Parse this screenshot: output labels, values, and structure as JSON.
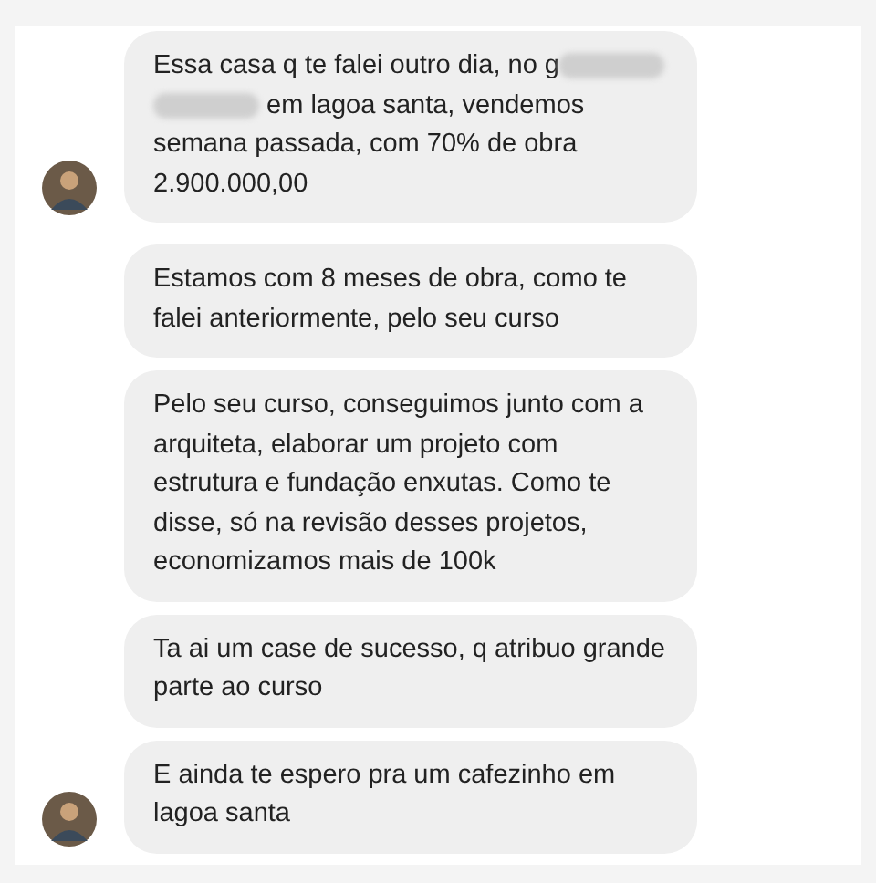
{
  "groups": [
    {
      "messages": [
        {
          "parts": [
            {
              "kind": "text",
              "text": "Essa casa q te falei outro dia, no g"
            },
            {
              "kind": "redacted"
            },
            {
              "kind": "break"
            },
            {
              "kind": "redacted"
            },
            {
              "kind": "text",
              "text": " em lagoa santa, vendemos semana passada, com 70% de obra 2.900.000,00"
            }
          ]
        }
      ]
    },
    {
      "messages": [
        {
          "parts": [
            {
              "kind": "text",
              "text": "Estamos com 8 meses de obra, como te falei anteriormente, pelo seu curso"
            }
          ]
        },
        {
          "parts": [
            {
              "kind": "text",
              "text": "Pelo seu curso, conseguimos junto com a arquiteta, elaborar um projeto com estrutura e fundação enxutas. Como te disse, só na revisão desses projetos, economizamos mais de 100k"
            }
          ]
        },
        {
          "parts": [
            {
              "kind": "text",
              "text": "Ta ai um case de sucesso, q atribuo grande parte ao curso"
            }
          ]
        },
        {
          "parts": [
            {
              "kind": "text",
              "text": "E ainda te espero pra um cafezinho em lagoa santa"
            }
          ]
        }
      ]
    }
  ]
}
